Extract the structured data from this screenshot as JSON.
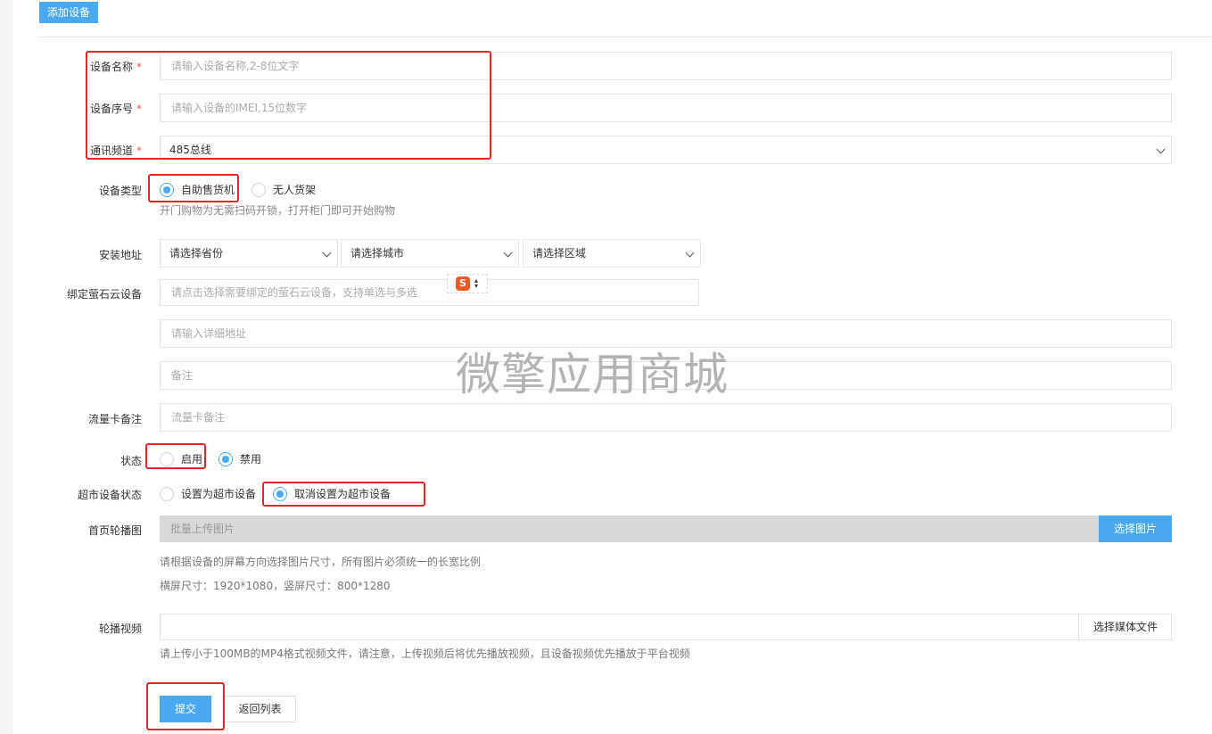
{
  "header": {
    "tab_label": "添加设备"
  },
  "fields": {
    "device_name": {
      "label": "设备名称",
      "required_mark": "*",
      "placeholder": "请输入设备名称,2-8位文字"
    },
    "device_serial": {
      "label": "设备序号",
      "required_mark": "*",
      "placeholder": "请输入设备的IMEI,15位数字"
    },
    "comm_channel": {
      "label": "通讯频道",
      "required_mark": "*",
      "value": "485总线"
    },
    "device_type": {
      "label": "设备类型",
      "options": [
        {
          "label": "自助售货机",
          "selected": true
        },
        {
          "label": "无人货架",
          "selected": false
        }
      ],
      "hint": "开门购物为无需扫码开锁，打开柜门即可开始购物"
    },
    "install_address": {
      "label": "安装地址",
      "province": "请选择省份",
      "city": "请选择城市",
      "district": "请选择区域"
    },
    "ezviz": {
      "label": "绑定萤石云设备",
      "placeholder": "请点击选择需要绑定的萤石云设备，支持单选与多选"
    },
    "detail_address": {
      "placeholder": "请输入详细地址"
    },
    "remark": {
      "placeholder": "备注"
    },
    "sim_remark": {
      "label": "流量卡备注",
      "placeholder": "流量卡备注"
    },
    "status": {
      "label": "状态",
      "options": [
        {
          "label": "启用",
          "selected": false
        },
        {
          "label": "禁用",
          "selected": true
        }
      ]
    },
    "supermarket": {
      "label": "超市设备状态",
      "options": [
        {
          "label": "设置为超市设备",
          "selected": false
        },
        {
          "label": "取消设置为超市设备",
          "selected": true
        }
      ]
    },
    "carousel": {
      "label": "首页轮播图",
      "placeholder": "批量上传图片",
      "button": "选择图片",
      "hint1": "请根据设备的屏幕方向选择图片尺寸，所有图片必须统一的长宽比例",
      "hint2": "横屏尺寸：1920*1080，竖屏尺寸：800*1280"
    },
    "video": {
      "label": "轮播视频",
      "button": "选择媒体文件",
      "hint": "请上传小于100MB的MP4格式视频文件，请注意，上传视频后将优先播放视频，且设备视频优先播放于平台视频"
    }
  },
  "actions": {
    "submit": "提交",
    "back": "返回列表"
  },
  "watermark": "微擎应用商城",
  "ime_logo": "S",
  "colors": {
    "accent": "#4aa8f0",
    "annotation": "#e0262b",
    "required": "#e8594c"
  }
}
